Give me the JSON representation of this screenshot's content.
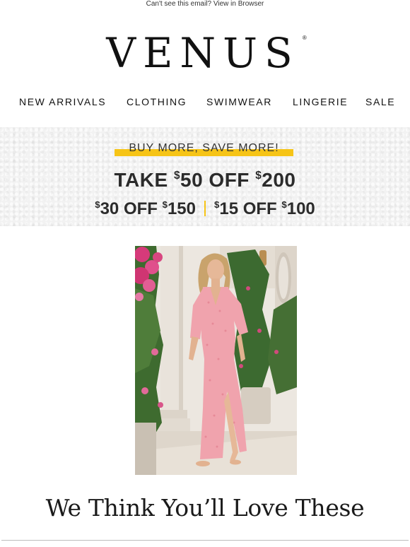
{
  "preheader": {
    "text": "Can't see this email? View in Browser"
  },
  "brand": {
    "logo_text": "VENUS",
    "reg_mark": "®"
  },
  "nav": {
    "items": [
      "NEW ARRIVALS",
      "CLOTHING",
      "SWIMWEAR",
      "LINGERIE",
      "SALE"
    ]
  },
  "promo": {
    "tagline": "BUY MORE, SAVE MORE!",
    "line1": {
      "take": "TAKE ",
      "cur1": "$",
      "amt1": "50 OFF ",
      "cur2": "$",
      "amt2": "200"
    },
    "offer2": {
      "cur1": "$",
      "amt1": "30 OFF ",
      "cur2": "$",
      "amt2": "150"
    },
    "offer3": {
      "cur1": "$",
      "amt1": "15 OFF ",
      "cur2": "$",
      "amt2": "100"
    },
    "highlight_color": "#f6c417",
    "text_color": "#2b2b2b"
  },
  "hero": {
    "subject": "model-in-pink-floral-maxi-dress"
  },
  "section": {
    "title": "We Think You’ll Love These"
  }
}
